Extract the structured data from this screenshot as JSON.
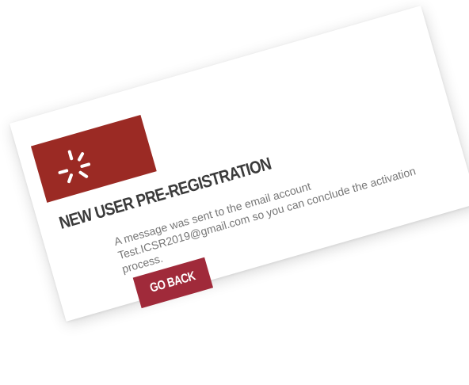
{
  "brand": {
    "logo_icon": "starburst-icon",
    "logo_color": "#9b2a24"
  },
  "page": {
    "title": "NEW USER PRE-REGISTRATION",
    "message_lines": [
      "A message was sent to the email account",
      "Test.ICSR2019@gmail.com so you can conclude the activation",
      "process."
    ]
  },
  "actions": {
    "go_back_label": "GO BACK",
    "button_color": "#a02a3a"
  }
}
